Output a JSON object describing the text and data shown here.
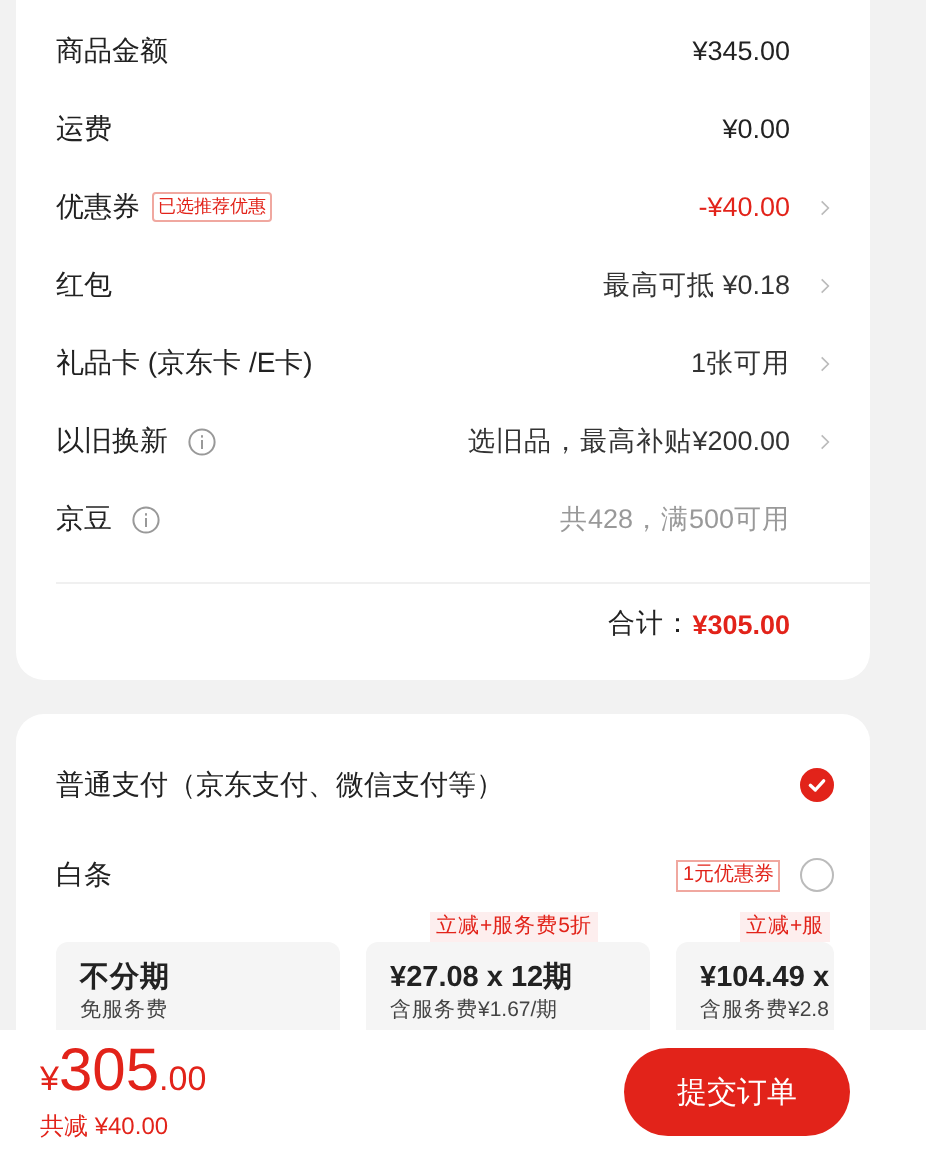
{
  "fees": [
    {
      "label": "商品金额",
      "value": "¥345.00",
      "kind": "strong",
      "chevron": false,
      "info": false
    },
    {
      "label": "运费",
      "value": "¥0.00",
      "kind": "strong",
      "chevron": false,
      "info": false
    },
    {
      "label": "优惠券",
      "tag": "已选推荐优惠",
      "value": "-¥40.00",
      "kind": "discount",
      "chevron": true,
      "info": false
    },
    {
      "label": "红包",
      "value": "最高可抵 ¥0.18",
      "kind": "normal",
      "chevron": true,
      "info": false
    },
    {
      "label": "礼品卡 (京东卡 /E卡)",
      "value": "1张可用",
      "kind": "normal",
      "chevron": true,
      "info": false
    },
    {
      "label": "以旧换新",
      "value": "选旧品，最高补贴¥200.00",
      "kind": "normal",
      "chevron": true,
      "info": true
    },
    {
      "label": "京豆",
      "value": "共428，满500可用",
      "kind": "muted",
      "chevron": false,
      "info": true
    }
  ],
  "total": {
    "label": "合计：",
    "amount": "¥305.00"
  },
  "payments": [
    {
      "label": "普通支付（京东支付、微信支付等）",
      "selected": true
    },
    {
      "label": "白条",
      "tag": "1元优惠券",
      "selected": false
    }
  ],
  "installments": [
    {
      "title": "不分期",
      "note": "免服务费"
    },
    {
      "tag": "立减+服务费5折",
      "title": "¥27.08 x 12期",
      "note": "含服务费¥1.67/期"
    },
    {
      "tag": "立减+服",
      "title": "¥104.49 x",
      "note": "含服务费¥2.8"
    }
  ],
  "footer": {
    "currency": "¥",
    "integer": "305",
    "decimals": ".00",
    "saved": "共减 ¥40.00",
    "submit": "提交订单"
  }
}
